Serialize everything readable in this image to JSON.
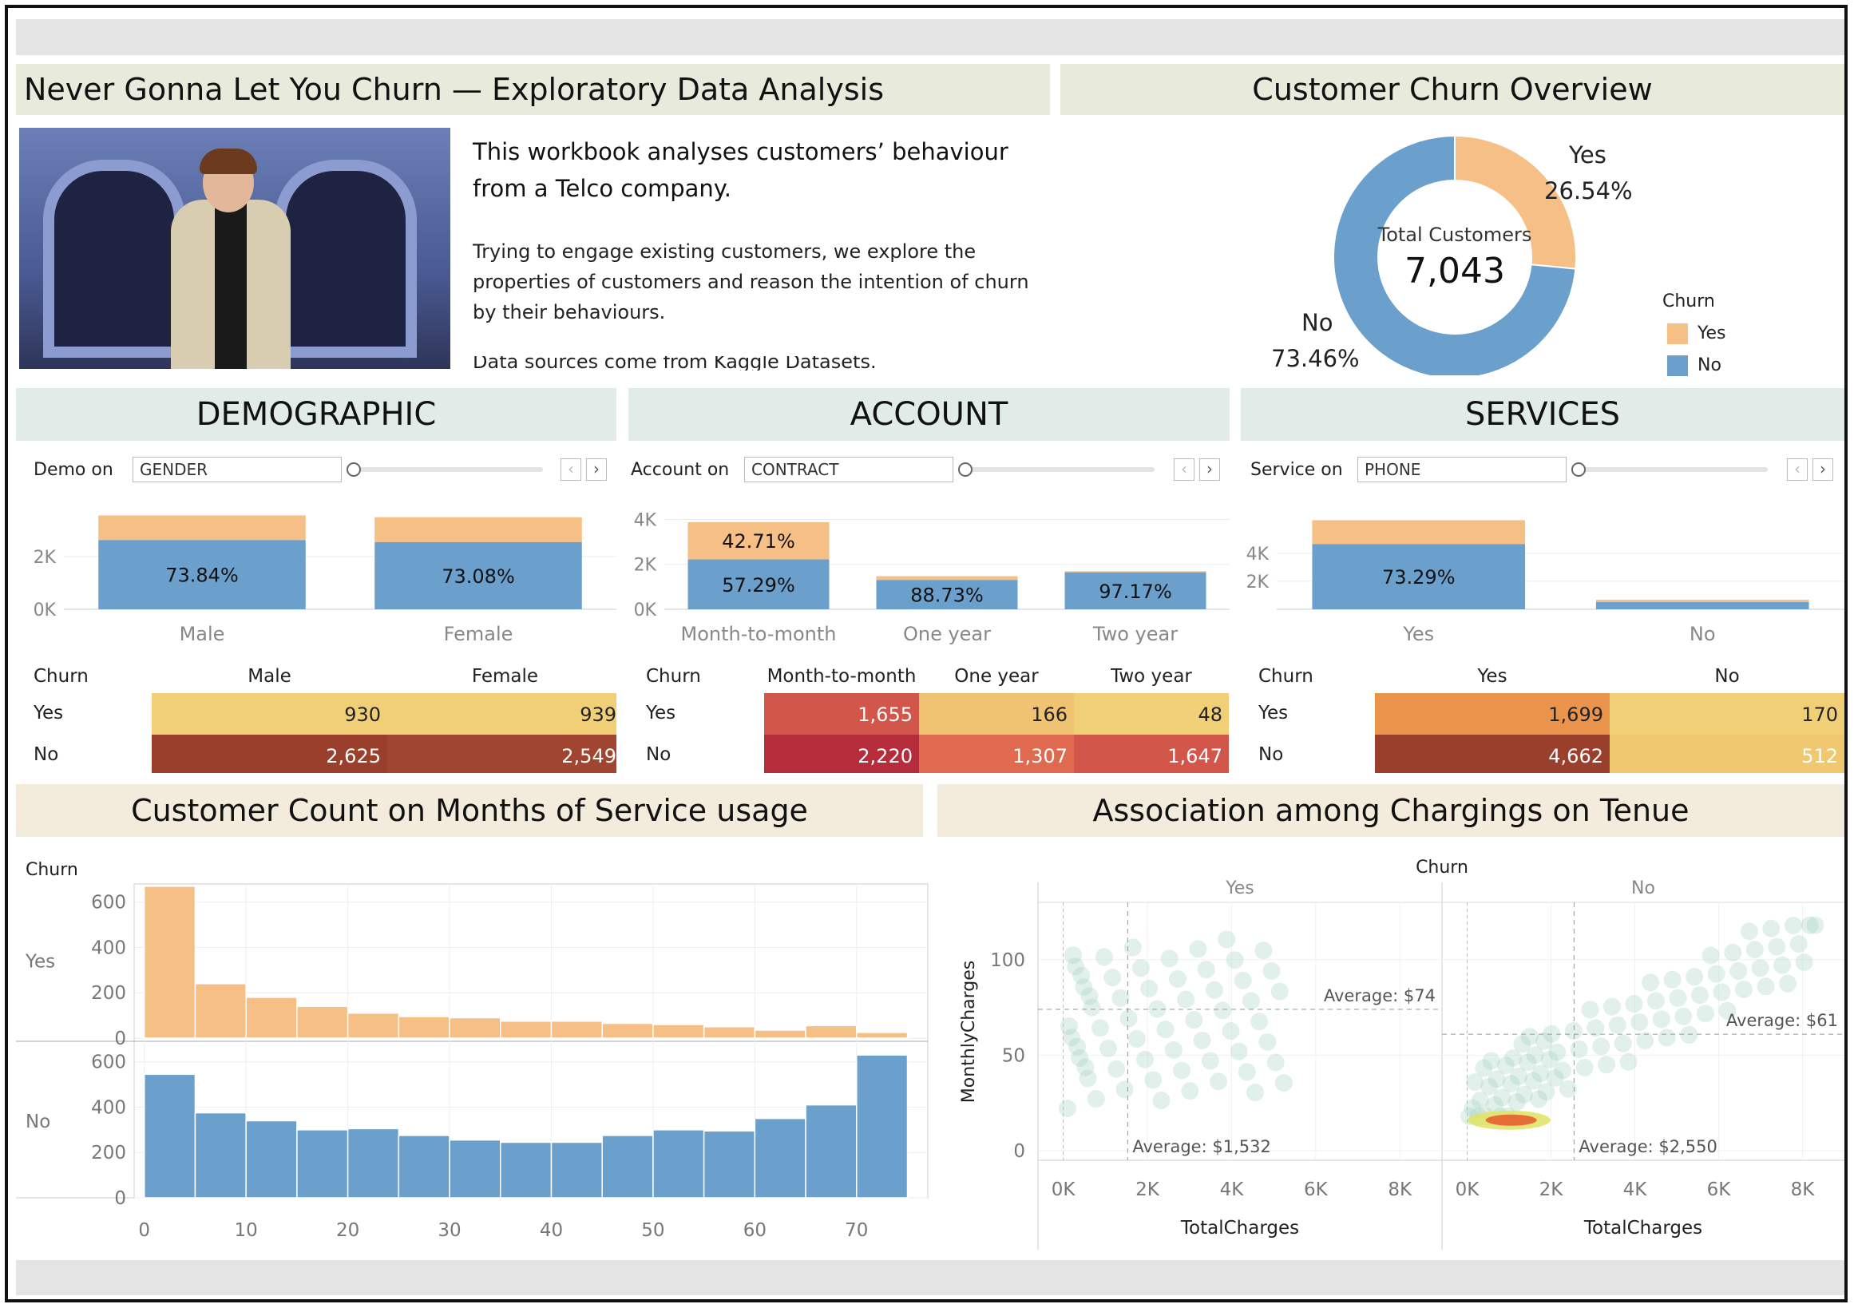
{
  "intro": {
    "title": "Never Gonna Let You Churn — Exploratory Data Analysis",
    "heading_line1": "This workbook analyses customers’ behaviour",
    "heading_line2": "from a Telco company.",
    "body_line1": "Trying to engage existing customers, we explore the",
    "body_line2": "properties of customers and reason the intention of churn",
    "body_line3": "by their behaviours.",
    "body_line4": "Data sources come from Kaggle Datasets."
  },
  "colors": {
    "yes": "#f5bf86",
    "no": "#6b9fcc",
    "title_bg": "#e8eadc",
    "section_bg": "#e1ece8",
    "bottom_title_bg": "#f3ebdc"
  },
  "overview": {
    "title": "Customer Churn Overview",
    "center_label": "Total Customers",
    "center_value": "7,043",
    "yes_label": "Yes",
    "yes_pct": "26.54%",
    "no_label": "No",
    "no_pct": "73.46%",
    "legend_title": "Churn",
    "legend_yes": "Yes",
    "legend_no": "No"
  },
  "demographic": {
    "title": "DEMOGRAPHIC",
    "control_label": "Demo on",
    "control_value": "GENDER",
    "row_header": "Churn",
    "row_yes": "Yes",
    "row_no": "No"
  },
  "account": {
    "title": "ACCOUNT",
    "control_label": "Account on",
    "control_value": "CONTRACT",
    "row_header": "Churn",
    "row_yes": "Yes",
    "row_no": "No"
  },
  "services": {
    "title": "SERVICES",
    "control_label": "Service on",
    "control_value": "PHONE",
    "row_header": "Churn",
    "row_yes": "Yes",
    "row_no": "No"
  },
  "nav": {
    "prev": "‹",
    "next": "›"
  },
  "bottom": {
    "tenure_title": "Customer Count on Months of Service usage",
    "charges_title": "Association among Chargings on Tenue"
  },
  "chart_data": [
    {
      "id": "demographic",
      "type": "bar",
      "stacked": true,
      "categories": [
        "Male",
        "Female"
      ],
      "series": [
        {
          "name": "No",
          "values": [
            2625,
            2549
          ]
        },
        {
          "name": "Yes",
          "values": [
            930,
            939
          ]
        }
      ],
      "bar_labels": [
        "73.84%",
        "73.08%"
      ],
      "yticks": [
        "0K",
        "2K"
      ],
      "ylim": [
        0,
        3600
      ]
    },
    {
      "id": "account",
      "type": "bar",
      "stacked": true,
      "categories": [
        "Month-to-month",
        "One year",
        "Two year"
      ],
      "series": [
        {
          "name": "No",
          "values": [
            2220,
            1307,
            1647
          ]
        },
        {
          "name": "Yes",
          "values": [
            1655,
            166,
            48
          ]
        }
      ],
      "bar_labels_no": [
        "57.29%",
        "88.73%",
        "97.17%"
      ],
      "bar_labels_yes": [
        "42.71%",
        "",
        ""
      ],
      "yticks": [
        "0K",
        "2K",
        "4K"
      ],
      "ylim": [
        0,
        4300
      ]
    },
    {
      "id": "services",
      "type": "bar",
      "stacked": true,
      "categories": [
        "Yes",
        "No"
      ],
      "series": [
        {
          "name": "No",
          "values": [
            4662,
            512
          ]
        },
        {
          "name": "Yes",
          "values": [
            1699,
            170
          ]
        }
      ],
      "bar_labels": [
        "73.29%",
        ""
      ],
      "yticks": [
        "2K",
        "4K"
      ],
      "ylim": [
        0,
        6900
      ]
    },
    {
      "id": "demographic_table",
      "type": "table",
      "columns": [
        "Male",
        "Female"
      ],
      "rows": [
        {
          "label": "Yes",
          "values": [
            "930",
            "939"
          ],
          "colors": [
            "#f0cf76",
            "#f0cf76"
          ]
        },
        {
          "label": "No",
          "values": [
            "2,625",
            "2,549"
          ],
          "colors": [
            "#9a3f2c",
            "#9f4530"
          ]
        }
      ]
    },
    {
      "id": "account_table",
      "type": "table",
      "columns": [
        "Month-to-month",
        "One year",
        "Two year"
      ],
      "rows": [
        {
          "label": "Yes",
          "values": [
            "1,655",
            "166",
            "48"
          ],
          "colors": [
            "#d2564a",
            "#efc371",
            "#f0cf76"
          ]
        },
        {
          "label": "No",
          "values": [
            "2,220",
            "1,307",
            "1,647"
          ],
          "colors": [
            "#b52c3b",
            "#e06a4f",
            "#d2564a"
          ]
        }
      ]
    },
    {
      "id": "services_table",
      "type": "table",
      "columns": [
        "Yes",
        "No"
      ],
      "rows": [
        {
          "label": "Yes",
          "values": [
            "1,699",
            "170"
          ],
          "colors": [
            "#e9944a",
            "#f0cf76"
          ]
        },
        {
          "label": "No",
          "values": [
            "4,662",
            "512"
          ],
          "colors": [
            "#9a3f2c",
            "#efc870"
          ]
        }
      ]
    },
    {
      "id": "overview_donut",
      "type": "pie",
      "categories": [
        "Yes",
        "No"
      ],
      "values": [
        26.54,
        73.46
      ]
    },
    {
      "id": "tenure_histogram",
      "type": "bar",
      "row_header": "Churn",
      "bin_width": 5,
      "bins_start": [
        0,
        5,
        10,
        15,
        20,
        25,
        30,
        35,
        40,
        45,
        50,
        55,
        60,
        65,
        70
      ],
      "xticks": [
        0,
        10,
        20,
        30,
        40,
        50,
        60,
        70
      ],
      "xlim": [
        -1,
        77
      ],
      "yticks": [
        0,
        200,
        400,
        600
      ],
      "ylim": [
        0,
        680
      ],
      "series": [
        {
          "name": "Yes",
          "values": [
            670,
            240,
            180,
            140,
            110,
            95,
            90,
            75,
            75,
            65,
            60,
            50,
            35,
            55,
            25
          ]
        },
        {
          "name": "No",
          "values": [
            545,
            375,
            340,
            300,
            305,
            275,
            255,
            245,
            245,
            275,
            300,
            295,
            350,
            410,
            630
          ]
        }
      ]
    },
    {
      "id": "charges_scatter",
      "type": "scatter",
      "panel_header": "Churn",
      "panels": [
        "Yes",
        "No"
      ],
      "xlabel": "TotalCharges",
      "ylabel": "MonthlyCharges",
      "xticks": [
        "0K",
        "2K",
        "4K",
        "6K",
        "8K"
      ],
      "xtick_values": [
        0,
        2000,
        4000,
        6000,
        8000
      ],
      "xlim": [
        -600,
        9000
      ],
      "yticks": [
        0,
        50,
        100
      ],
      "ylim": [
        -5,
        130
      ],
      "averages": [
        {
          "panel": "Yes",
          "total": 1532,
          "monthly": 74,
          "total_label": "Average: $1,532",
          "monthly_label": "Average: $74"
        },
        {
          "panel": "No",
          "total": 2550,
          "monthly": 61,
          "total_label": "Average: $2,550",
          "monthly_label": "Average: $61"
        }
      ]
    }
  ]
}
